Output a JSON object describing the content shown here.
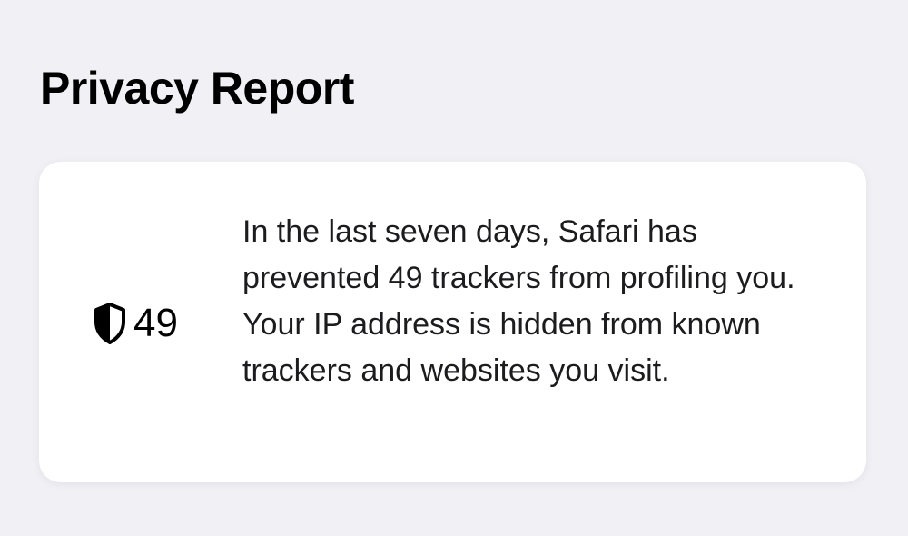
{
  "page": {
    "title": "Privacy Report"
  },
  "privacy_card": {
    "icon": "shield-half-filled-icon",
    "tracker_count": "49",
    "description": "In the last seven days, Safari has prevented 49 trackers from profiling you. Your IP address is hidden from known trackers and websites you visit."
  },
  "colors": {
    "background": "#f0f0f5",
    "card": "#ffffff",
    "text": "#000000"
  }
}
